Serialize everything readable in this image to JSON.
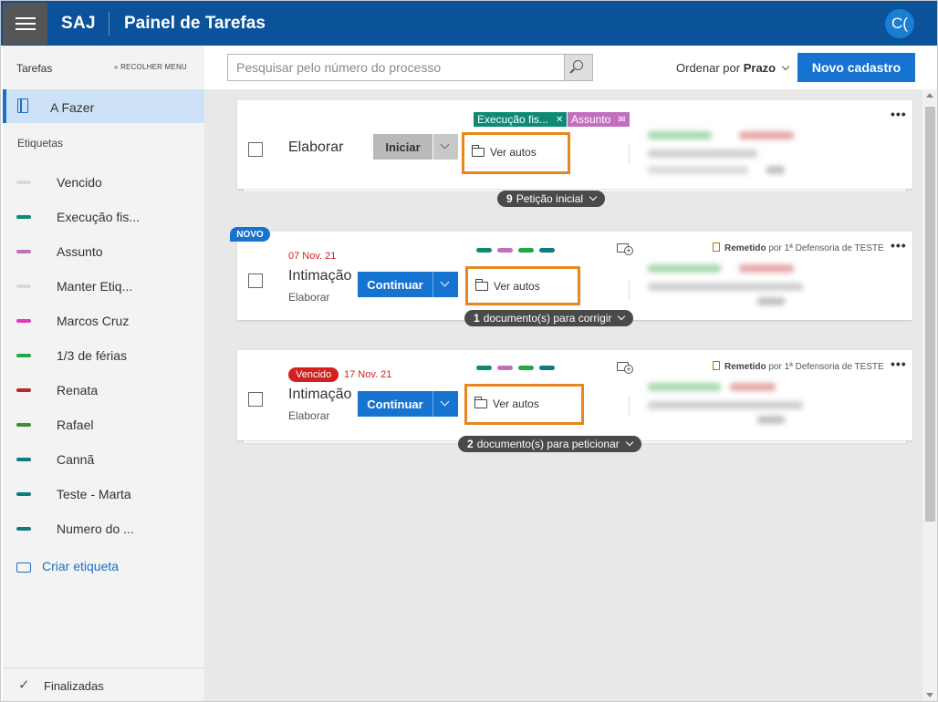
{
  "header": {
    "brand": "SAJ",
    "title": "Painel de Tarefas",
    "avatar_initials": "C("
  },
  "sidebar": {
    "heading": "Tarefas",
    "collapse_label": "« RECOLHER MENU",
    "active_item": "A Fazer",
    "tags_heading": "Etiquetas",
    "tags": [
      {
        "label": "Vencido",
        "color": "#d9d9d9"
      },
      {
        "label": "Execução fis...",
        "color": "#0d8a74"
      },
      {
        "label": "Assunto",
        "color": "#c36fbd"
      },
      {
        "label": "Manter Etiq...",
        "color": "#d9d9d9"
      },
      {
        "label": "Marcos Cruz",
        "color": "#e23bb5"
      },
      {
        "label": "1/3 de férias",
        "color": "#22a846"
      },
      {
        "label": "Renata",
        "color": "#b72a2a"
      },
      {
        "label": "Rafael",
        "color": "#3d8f32"
      },
      {
        "label": "Cannã",
        "color": "#0f7a80"
      },
      {
        "label": "Teste - Marta",
        "color": "#0f7a80"
      },
      {
        "label": "Numero do ...",
        "color": "#0f7a80"
      }
    ],
    "create_tag": "Criar etiqueta",
    "finished": "Finalizadas"
  },
  "toolbar": {
    "search_placeholder": "Pesquisar pelo número do processo",
    "sort_label": "Ordenar por",
    "sort_value": "Prazo",
    "new_button": "Novo cadastro"
  },
  "cards": [
    {
      "title": "Elaborar",
      "action": "Iniciar",
      "tag_chips": [
        "Execução fis...",
        "Assunto"
      ],
      "autos": "Ver autos",
      "footer_count": "9",
      "footer_text": "Petição inicial"
    },
    {
      "badge": "NOVO",
      "date": "07 Nov. 21",
      "title": "Intimação",
      "subtitle": "Elaborar",
      "action": "Continuar",
      "autos": "Ver autos",
      "remetido": "Remetido",
      "remetido_by": "por 1ª Defensoria de TESTE",
      "footer_count": "1",
      "footer_text": "documento(s) para corrigir"
    },
    {
      "badge": "Vencido",
      "date": "17 Nov. 21",
      "title": "Intimação",
      "subtitle": "Elaborar",
      "action": "Continuar",
      "autos": "Ver autos",
      "remetido": "Remetido",
      "remetido_by": "por 1ª Defensoria de TESTE",
      "footer_count": "2",
      "footer_text": "documento(s) para peticionar"
    }
  ],
  "colors": {
    "header": "#0a5299",
    "primary": "#1673cf",
    "highlight": "#e8871e",
    "due": "#d32020"
  }
}
